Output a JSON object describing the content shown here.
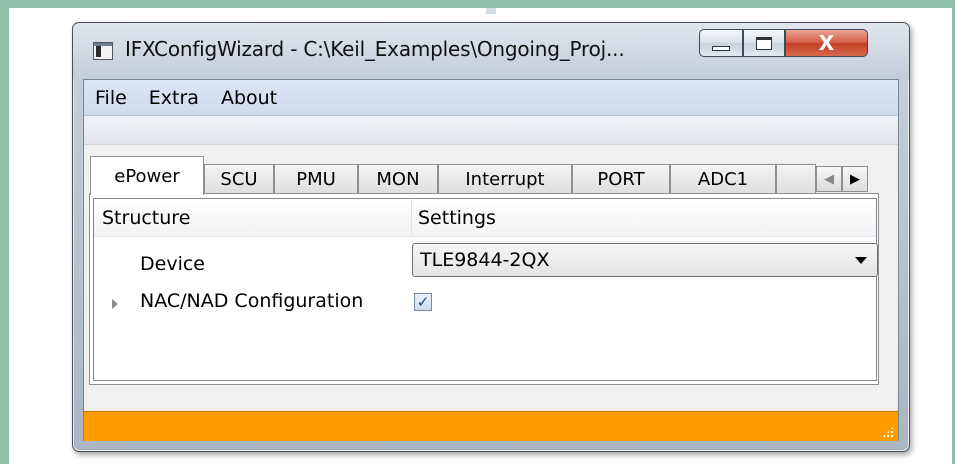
{
  "window": {
    "title": "IFXConfigWizard - C:\\Keil_Examples\\Ongoing_Proj...",
    "close_glyph": "X"
  },
  "menu": {
    "items": [
      "File",
      "Extra",
      "About"
    ]
  },
  "tabs": {
    "items": [
      "ePower",
      "SCU",
      "PMU",
      "MON",
      "Interrupt",
      "PORT",
      "ADC1"
    ],
    "active": "ePower",
    "scroll_left": "◀",
    "scroll_right": "▶"
  },
  "tree": {
    "columns": [
      "Structure",
      "Settings"
    ],
    "rows": [
      {
        "label": "Device",
        "value": "TLE9844-2QX",
        "control": "dropdown"
      },
      {
        "label": "NAC/NAD Configuration",
        "checked": true,
        "check_glyph": "✓",
        "control": "checkbox"
      }
    ]
  },
  "statusbar": {
    "color": "#ff9c00"
  },
  "icons": {
    "app": "app-window-icon",
    "minimize": "minimize-icon",
    "maximize": "maximize-icon",
    "close": "close-icon",
    "expander": "expand-arrow-icon",
    "dropdown": "chevron-down-icon",
    "grip": "resize-grip-icon"
  }
}
